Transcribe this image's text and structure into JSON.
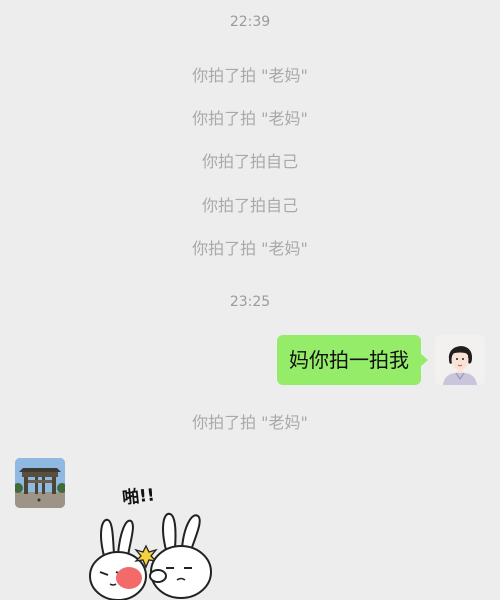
{
  "messages": {
    "time_1": "22:39",
    "pat_1": "你拍了拍 \"老妈\"",
    "pat_2": "你拍了拍 \"老妈\"",
    "pat_3": "你拍了拍自己",
    "pat_4": "你拍了拍自己",
    "pat_5": "你拍了拍 \"老妈\"",
    "time_2": "23:25",
    "outgoing_text": "妈你拍一拍我",
    "pat_6": "你拍了拍 \"老妈\"",
    "sticker_caption": "啪!!"
  },
  "colors": {
    "background": "#ededed",
    "outgoing_bubble": "#95ec69",
    "system_text": "#a9a9a9"
  }
}
